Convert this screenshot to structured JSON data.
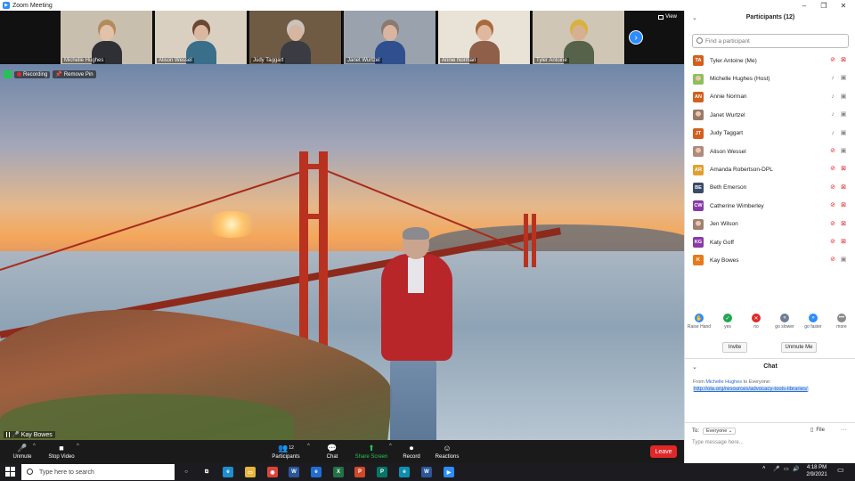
{
  "window": {
    "title": "Zoom Meeting",
    "minimize": "–",
    "maximize": "❐",
    "close": "✕"
  },
  "thumbnails": [
    {
      "name": "Michelle Hughes",
      "bg": "#c9bfae",
      "skin": "#e2c2a8",
      "shirt": "#2f3036",
      "hair": "#b38a5a"
    },
    {
      "name": "Alison Wessel",
      "bg": "#d9d0c2",
      "skin": "#dcb7a0",
      "shirt": "#3a6f8a",
      "hair": "#6b4630"
    },
    {
      "name": "Judy Taggart",
      "bg": "#6f5a44",
      "skin": "#d6b6a0",
      "shirt": "#3b3b44",
      "hair": "#c8c4bc"
    },
    {
      "name": "Janet Wurtzel",
      "bg": "#9aa3ad",
      "skin": "#d9b4a0",
      "shirt": "#2f4f8f",
      "hair": "#8a7b70"
    },
    {
      "name": "Annie Norman",
      "bg": "#e9e2d6",
      "skin": "#e0b8a0",
      "shirt": "#8f5f4a",
      "hair": "#a86a3a"
    },
    {
      "name": "Tyler Antoine",
      "bg": "#cfc6b6",
      "skin": "#d6b090",
      "shirt": "#56624a",
      "hair": "#d8b23a"
    }
  ],
  "view_label": "View",
  "next_arrow": "›",
  "recording": {
    "label": "Recording",
    "remove_pin": "Remove Pin"
  },
  "speaker_name": "Kay Bowes",
  "toolbar": {
    "unmute": "Unmute",
    "stop_video": "Stop Video",
    "participants": "Participants",
    "participants_count": "12",
    "chat": "Chat",
    "share_screen": "Share Screen",
    "record": "Record",
    "reactions": "Reactions",
    "leave": "Leave",
    "caret": "^"
  },
  "sidebar": {
    "title": "Participants (12)",
    "chevron": "⌄",
    "search_placeholder": "Find a participant",
    "participants": [
      {
        "initials": "TA",
        "name": "Tyler Antoine (Me)",
        "color": "#d35f1c",
        "mic": "off",
        "cam": "off"
      },
      {
        "initials": "",
        "name": "Michelle Hughes (Host)",
        "color": "#8fbf5a",
        "mic": "on",
        "cam": "on"
      },
      {
        "initials": "AN",
        "name": "Annie Norman",
        "color": "#d35f1c",
        "mic": "on",
        "cam": "on"
      },
      {
        "initials": "",
        "name": "Janet Wurtzel",
        "color": "#9a7a66",
        "mic": "on",
        "cam": "on"
      },
      {
        "initials": "JT",
        "name": "Judy Taggart",
        "color": "#d35f1c",
        "mic": "on",
        "cam": "on"
      },
      {
        "initials": "",
        "name": "Alison Wessel",
        "color": "#b08a7a",
        "mic": "off",
        "cam": "on"
      },
      {
        "initials": "AR",
        "name": "Amanda Robertson-DPL",
        "color": "#e0a030",
        "mic": "off",
        "cam": "off"
      },
      {
        "initials": "BE",
        "name": "Beth Emerson",
        "color": "#3a4a6a",
        "mic": "off",
        "cam": "off"
      },
      {
        "initials": "CW",
        "name": "Catherine Wimberley",
        "color": "#8a3aa8",
        "mic": "off",
        "cam": "off"
      },
      {
        "initials": "",
        "name": "Jen Wilson",
        "color": "#a08070",
        "mic": "off",
        "cam": "off"
      },
      {
        "initials": "KG",
        "name": "Katy Goff",
        "color": "#8a3aa8",
        "mic": "off",
        "cam": "off"
      },
      {
        "initials": "K",
        "name": "Kay Bowes",
        "color": "#e87a1c",
        "mic": "off",
        "cam": "on"
      }
    ],
    "reactions": [
      {
        "label": "Raise Hand",
        "glyph": "✋",
        "color": "#2d8cff"
      },
      {
        "label": "yes",
        "glyph": "✓",
        "color": "#23a552"
      },
      {
        "label": "no",
        "glyph": "✕",
        "color": "#e02828"
      },
      {
        "label": "go slower",
        "glyph": "«",
        "color": "#6f7e96"
      },
      {
        "label": "go faster",
        "glyph": "»",
        "color": "#2d8cff"
      },
      {
        "label": "more",
        "glyph": "•••",
        "color": "#8a8a8a"
      }
    ],
    "invite": "Invite",
    "unmute_me": "Unmute Me"
  },
  "chat": {
    "title": "Chat",
    "from_prefix": "From",
    "from_name": "Michelle Hughes",
    "from_suffix": "to Everyone:",
    "message": "http://ola.org/resources/advocacy-tools-libraries/",
    "to_label": "To:",
    "to_value": "Everyone",
    "file_label": "File",
    "more": "···",
    "input_placeholder": "Type message here..."
  },
  "taskbar": {
    "search_placeholder": "Type here to search",
    "time": "4:18 PM",
    "date": "2/9/2021",
    "apps": [
      {
        "name": "cortana",
        "glyph": "○",
        "color": "transparent"
      },
      {
        "name": "task-view",
        "glyph": "⧉",
        "color": "transparent"
      },
      {
        "name": "edge",
        "glyph": "e",
        "color": "#1d8fd0"
      },
      {
        "name": "file-explorer",
        "glyph": "▭",
        "color": "#e8b63a"
      },
      {
        "name": "chrome",
        "glyph": "◉",
        "color": "#db4437"
      },
      {
        "name": "word",
        "glyph": "W",
        "color": "#2b579a"
      },
      {
        "name": "ie",
        "glyph": "e",
        "color": "#1f6fd0"
      },
      {
        "name": "excel",
        "glyph": "X",
        "color": "#217346"
      },
      {
        "name": "powerpoint",
        "glyph": "P",
        "color": "#d24726"
      },
      {
        "name": "publisher",
        "glyph": "P",
        "color": "#077568"
      },
      {
        "name": "edge-2",
        "glyph": "e",
        "color": "#0f8fb0"
      },
      {
        "name": "word-2",
        "glyph": "W",
        "color": "#2b579a"
      },
      {
        "name": "zoom",
        "glyph": "▶",
        "color": "#2d8cff"
      }
    ]
  }
}
